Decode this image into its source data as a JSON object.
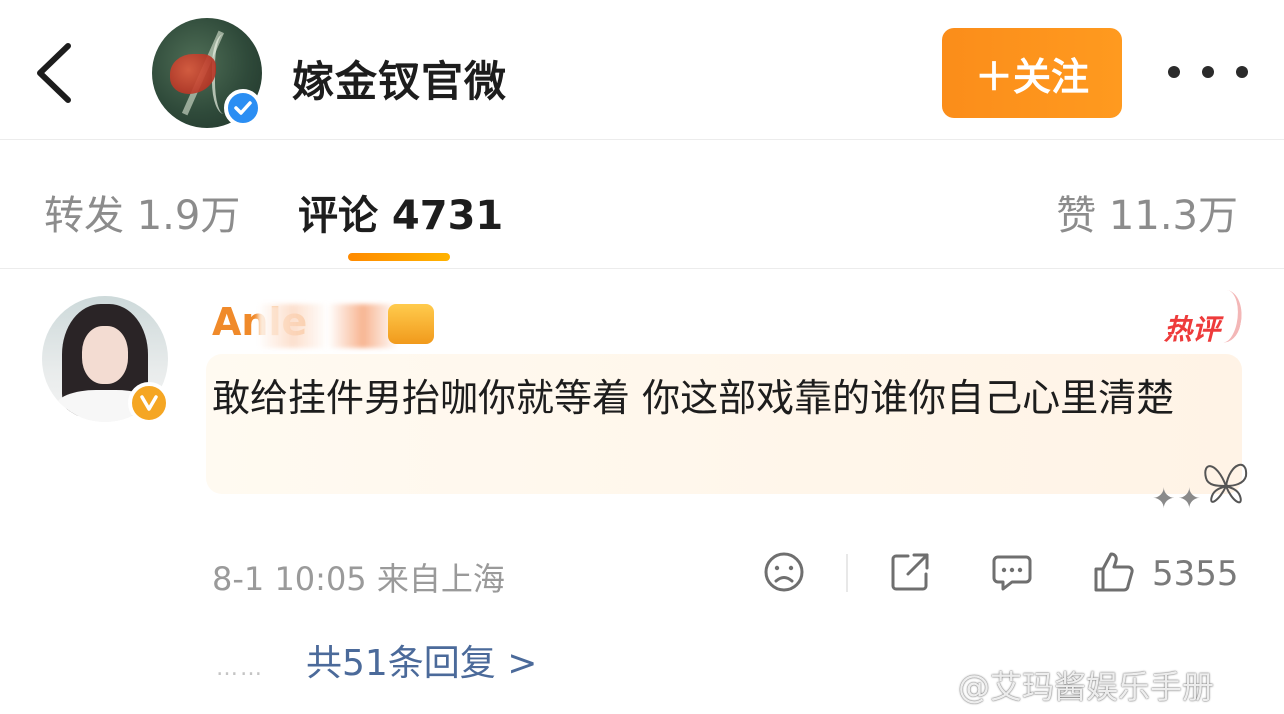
{
  "header": {
    "title": "嫁金钗官微",
    "follow_label": "＋关注",
    "verified": true
  },
  "tabs": {
    "repost": "转发 1.9万",
    "comments": "评论 4731",
    "likes": "赞 11.3万",
    "active": "comments",
    "accent": "#ff9a1f"
  },
  "comment": {
    "username": "Anle",
    "hot_label": "热评",
    "text": "敢给挂件男抬咖你就等着 你这部戏靠的谁你自己心里清楚",
    "meta": "8-1 10:05 来自上海",
    "like_count": "5355",
    "replies_link": "共51条回复 >",
    "replies_dots": "……",
    "sparkles": "✦✦"
  },
  "icons": {
    "back": "chevron-left-icon",
    "more": "more-horizontal-icon",
    "dislike": "frown-icon",
    "share": "share-icon",
    "reply": "comment-icon",
    "like": "thumbs-up-icon"
  },
  "colors": {
    "follow_button": "#fb8d1a",
    "username": "#f08a2a",
    "hot_badge": "#ee3b3b",
    "replies_link": "#4b6a9a",
    "verify_blue": "#2b8ef3",
    "verify_gold": "#f5a623"
  },
  "watermark": "@艾玛酱娱乐手册"
}
